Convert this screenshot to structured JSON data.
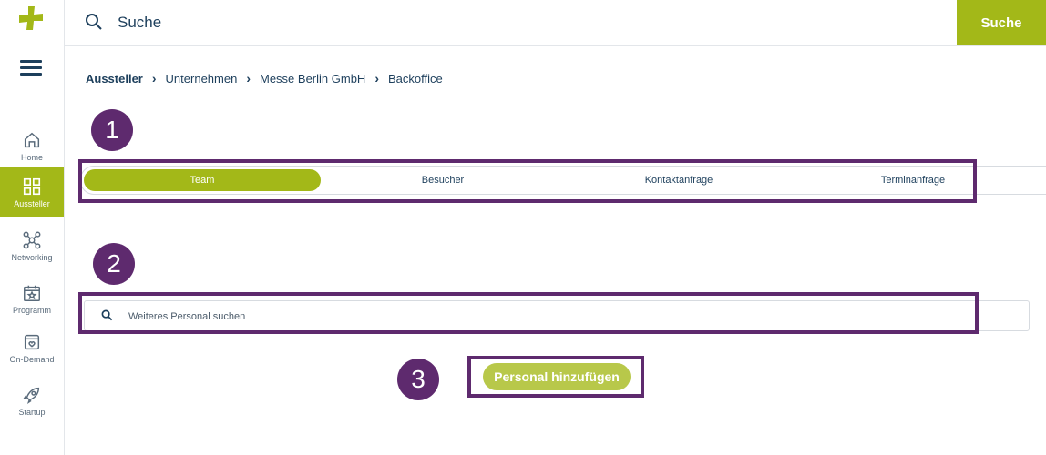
{
  "sidebar": {
    "items": [
      {
        "label": "Home",
        "icon": "home-icon"
      },
      {
        "label": "Aussteller",
        "icon": "grid-icon"
      },
      {
        "label": "Networking",
        "icon": "network-icon"
      },
      {
        "label": "Programm",
        "icon": "calendar-star-icon"
      },
      {
        "label": "On-Demand",
        "icon": "video-box-icon"
      },
      {
        "label": "Startup",
        "icon": "rocket-icon"
      }
    ]
  },
  "topbar": {
    "search_placeholder": "Suche",
    "search_button": "Suche"
  },
  "breadcrumb": [
    "Aussteller",
    "Unternehmen",
    "Messe Berlin GmbH",
    "Backoffice"
  ],
  "markers": [
    "1",
    "2",
    "3"
  ],
  "tabs": [
    "Team",
    "Besucher",
    "Kontaktanfrage",
    "Terminanfrage"
  ],
  "staff_search": {
    "placeholder": "Weiteres Personal suchen"
  },
  "add_button": "Personal hinzufügen",
  "colors": {
    "accent": "#a3b818",
    "marker": "#5e2a6e",
    "text": "#1d3f5c"
  }
}
